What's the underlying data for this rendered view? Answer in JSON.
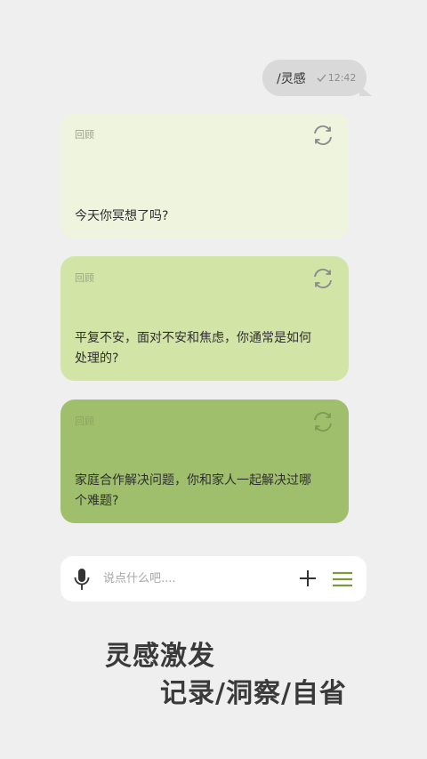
{
  "message": {
    "text": "/灵感",
    "time": "12:42"
  },
  "cards": [
    {
      "tag": "回顾",
      "text": "今天你冥想了吗?"
    },
    {
      "tag": "回顾",
      "text": "平复不安，面对不安和焦虑，你通常是如何处理的?"
    },
    {
      "tag": "回顾",
      "text": "家庭合作解决问题，你和家人一起解决过哪个难题?"
    }
  ],
  "input": {
    "placeholder": "说点什么吧...."
  },
  "tagline": {
    "line1": "灵感激发",
    "line2": "记录/洞察/自省"
  },
  "colors": {
    "background": "#efefef",
    "card1": "#eef4de",
    "card2": "#d3e4a7",
    "card3": "#a0bf6c",
    "accent": "#7a9a3a"
  },
  "icons": [
    "check-icon",
    "refresh-icon",
    "microphone-icon",
    "plus-icon",
    "menu-icon"
  ]
}
